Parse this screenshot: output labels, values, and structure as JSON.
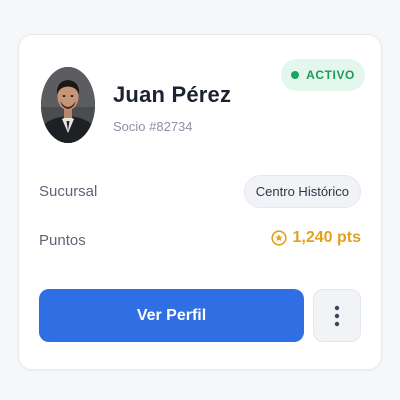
{
  "profile": {
    "name": "Juan Pérez",
    "member_id": "Socio #82734",
    "avatar": "profile-photo-icon"
  },
  "status": {
    "label": "ACTIVO",
    "icon": "status-dot-icon",
    "color": "#19a463",
    "background": "#e3f7ec"
  },
  "details": {
    "branch": {
      "label": "Sucursal",
      "value": "Centro Histórico"
    },
    "points": {
      "label": "Puntos",
      "value": "1,240 pts",
      "icon": "star-coin-icon",
      "color": "#e4a11b"
    }
  },
  "actions": {
    "view_profile_label": "Ver Perfil",
    "view_profile_color": "#2f6ee3",
    "more_icon": "more-vertical-icon"
  }
}
